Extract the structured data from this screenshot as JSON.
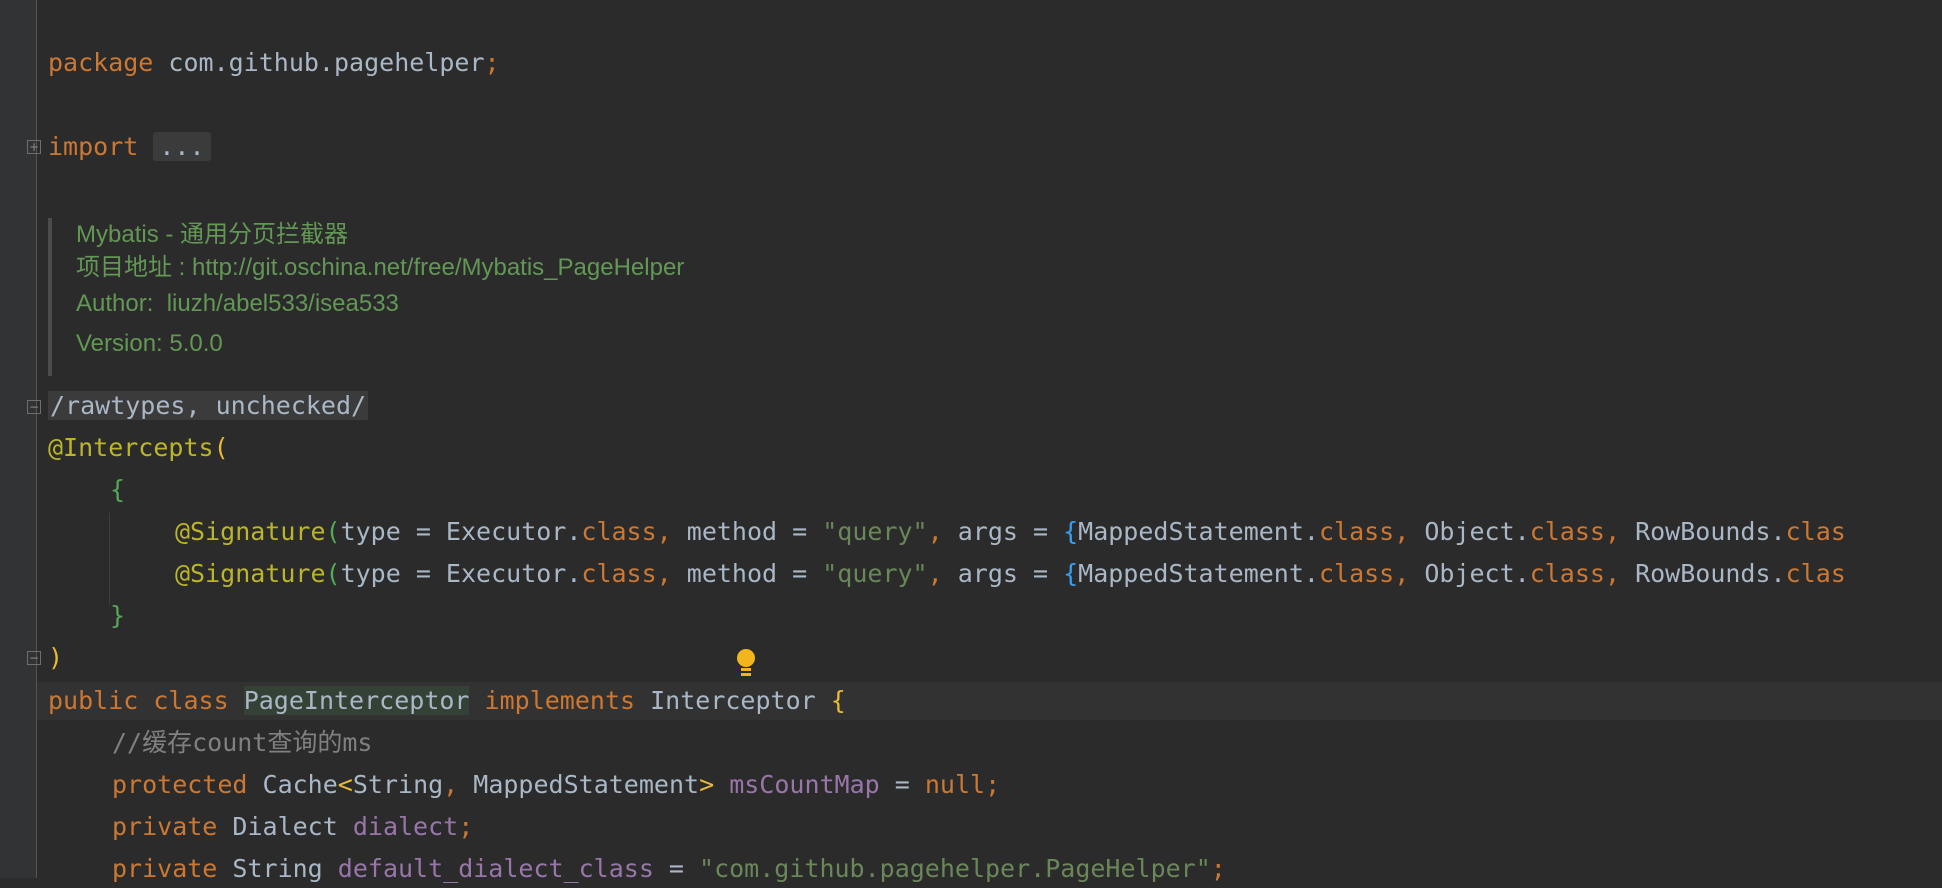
{
  "code": {
    "package_kw": "package",
    "package_name": "com.github.pagehelper",
    "semicolon": ";",
    "import_kw": "import",
    "import_fold": "...",
    "doc": {
      "line1": "Mybatis - 通用分页拦截器",
      "line2": "项目地址 : http://git.oschina.net/free/Mybatis_PageHelper",
      "line3": "Author:  liuzh/abel533/isea533",
      "line4": "Version: 5.0.0"
    },
    "suppress_text": "/rawtypes, unchecked/",
    "intercepts": "@Intercepts",
    "paren_open": "(",
    "paren_close": ")",
    "brace_open": "{",
    "brace_close": "}",
    "signature": "@Signature",
    "sig_type": "type = Executor.",
    "class_kw": "class",
    "comma": ", ",
    "sig_method": "method = ",
    "query_str": "\"query\"",
    "sig_args": "args = ",
    "arg1": "MappedStatement.",
    "arg2": "Object.",
    "arg3": "RowBounds.",
    "arg3_trunc": "clas",
    "public_kw": "public",
    "class_name": "PageInterceptor",
    "implements_kw": "implements",
    "interface_name": "Interceptor",
    "comment": "//缓存count查询的ms",
    "protected_kw": "protected",
    "cache_type": "Cache",
    "lt": "<",
    "gt": ">",
    "string_type": "String",
    "ms_type": "MappedStatement",
    "ms_count_map": "msCountMap",
    "assign": " = ",
    "null_kw": "null",
    "private_kw": "private",
    "dialect_type": "Dialect",
    "dialect_field": "dialect",
    "default_dialect_field": "default_dialect_class",
    "default_dialect_value": "\"com.github.pagehelper.PageHelper\""
  }
}
